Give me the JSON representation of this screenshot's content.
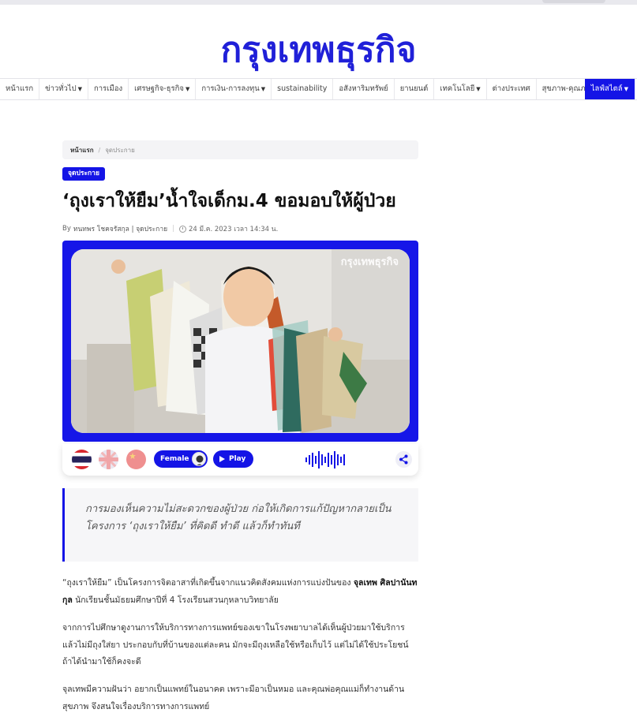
{
  "site": {
    "logo_text": "กรุงเทพธุรกิจ",
    "brand_color": "#1414e6"
  },
  "nav": {
    "items": [
      {
        "label": "หน้าแรก",
        "dropdown": false
      },
      {
        "label": "ข่าวทั่วไป",
        "dropdown": true
      },
      {
        "label": "การเมือง",
        "dropdown": false
      },
      {
        "label": "เศรษฐกิจ-ธุรกิจ",
        "dropdown": true
      },
      {
        "label": "การเงิน-การลงทุน",
        "dropdown": true
      },
      {
        "label": "sustainability",
        "dropdown": false
      },
      {
        "label": "อสังหาริมทรัพย์",
        "dropdown": false
      },
      {
        "label": "ยานยนต์",
        "dropdown": false
      },
      {
        "label": "เทคโนโลยี",
        "dropdown": true
      },
      {
        "label": "ต่างประเทศ",
        "dropdown": false
      },
      {
        "label": "สุขภาพ-คุณภาพชีวิต",
        "dropdown": true
      }
    ],
    "active_item": {
      "label": "ไลฟ์สไตล์",
      "dropdown": true
    }
  },
  "breadcrumb": {
    "home": "หน้าแรก",
    "separator": "/",
    "current": "จุดประกาย"
  },
  "article": {
    "category": "จุดประกาย",
    "title": "‘ถุงเราให้ยืม’น้ำใจเด็กม.4 ขอมอบให้ผู้ป่วย",
    "byline_by": "By",
    "author": "ทนทพร โชคจรัสกุล | จุดประกาย",
    "date": "24 มี.ค. 2023 เวลา 14:34 น.",
    "image_watermark": "กรุงเทพธุรกิจ",
    "quote": "การมองเห็นความไม่สะดวกของผู้ป่วย ก่อให้เกิดการแก้ปัญหากลายเป็นโครงการ ‘ถุงเราให้ยืม’ ที่คิดดี ทำดี แล้วก็ทำทันที",
    "p1_before": "“ถุงเราให้ยืม” เป็นโครงการจิตอาสาที่เกิดขึ้นจากแนวคิดสังคมแห่งการแบ่งปันของ ",
    "p1_bold": "จุลเทพ ศิลปานันทกุล",
    "p1_after": " นักเรียนชั้นมัธยมศึกษาปีที่ 4 โรงเรียนสวนกุหลาบวิทยาลัย",
    "p2": "จากการไปศึกษาดูงานการให้บริการทางการแพทย์ของเขาในโรงพยาบาลได้เห็นผู้ป่วยมาใช้บริการแล้วไม่มีถุงใส่ยา ประกอบกับที่บ้านของแต่ละคน มักจะมีถุงเหลือใช้หรือเก็บไว้ แต่ไม่ได้ใช้ประโยชน์ ถ้าได้นำมาใช้ก็คงจะดี",
    "p3": "จุลเทพมีความฝันว่า อยากเป็นแพทย์ในอนาคต เพราะมีอาเป็นหมอ และคุณพ่อคุณแม่ก็ทำงานด้านสุขภาพ จึงสนใจเรื่องบริการทางการแพทย์"
  },
  "player": {
    "languages": [
      "th-flag-icon",
      "uk-flag-icon",
      "cn-flag-icon"
    ],
    "voice_label": "Female",
    "play_label": "Play"
  }
}
